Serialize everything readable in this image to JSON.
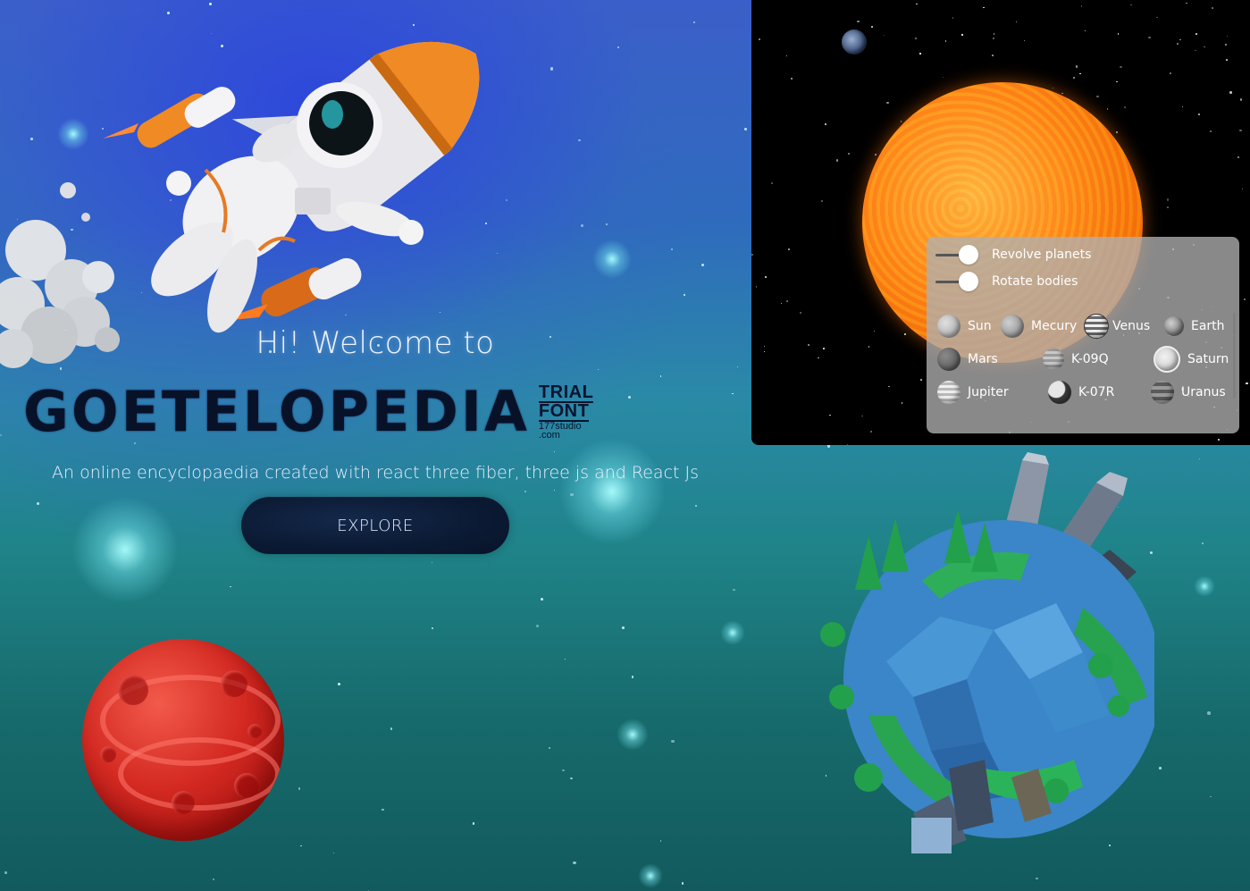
{
  "hero": {
    "greeting": "Hi! Welcome to",
    "title": "GOETELOPEDIA",
    "trial_badge_line1": "TRIAL",
    "trial_badge_line2": "FONT",
    "trial_badge_line3": "177studio",
    "trial_badge_line4": ".com",
    "subtitle": "An online encyclopaedia created with react three fiber, three js and React Js",
    "explore_label": "EXPLORE"
  },
  "solar_panel": {
    "toggles": [
      {
        "label": "Revolve planets",
        "on": true
      },
      {
        "label": "Rotate bodies",
        "on": true
      }
    ],
    "bodies": [
      {
        "label": "Sun",
        "icon": "sun-icon",
        "color": "#bdbdbd"
      },
      {
        "label": "Mecury",
        "icon": "mercury-icon",
        "color": "#9e9e9e"
      },
      {
        "label": "Venus",
        "icon": "venus-icon",
        "color": "#8a8a8a"
      },
      {
        "label": "Earth",
        "icon": "earth-icon",
        "color": "#7a7a7a"
      },
      {
        "label": "Mars",
        "icon": "mars-icon",
        "color": "#6a6a6a"
      },
      {
        "label": "K-09Q",
        "icon": "k09q-icon",
        "color": "#a8a8a8"
      },
      {
        "label": "Saturn",
        "icon": "saturn-icon",
        "color": "#c8c8c8"
      },
      {
        "label": "Jupiter",
        "icon": "jupiter-icon",
        "color": "#d4d4d4"
      },
      {
        "label": "K-07R",
        "icon": "k07r-icon",
        "color": "#5c5c5c"
      },
      {
        "label": "Uranus",
        "icon": "uranus-icon",
        "color": "#7c7c7c"
      }
    ]
  },
  "colors": {
    "sun": "#ff8a1e",
    "mars": "#d42a22",
    "button": "#0b1a33"
  }
}
